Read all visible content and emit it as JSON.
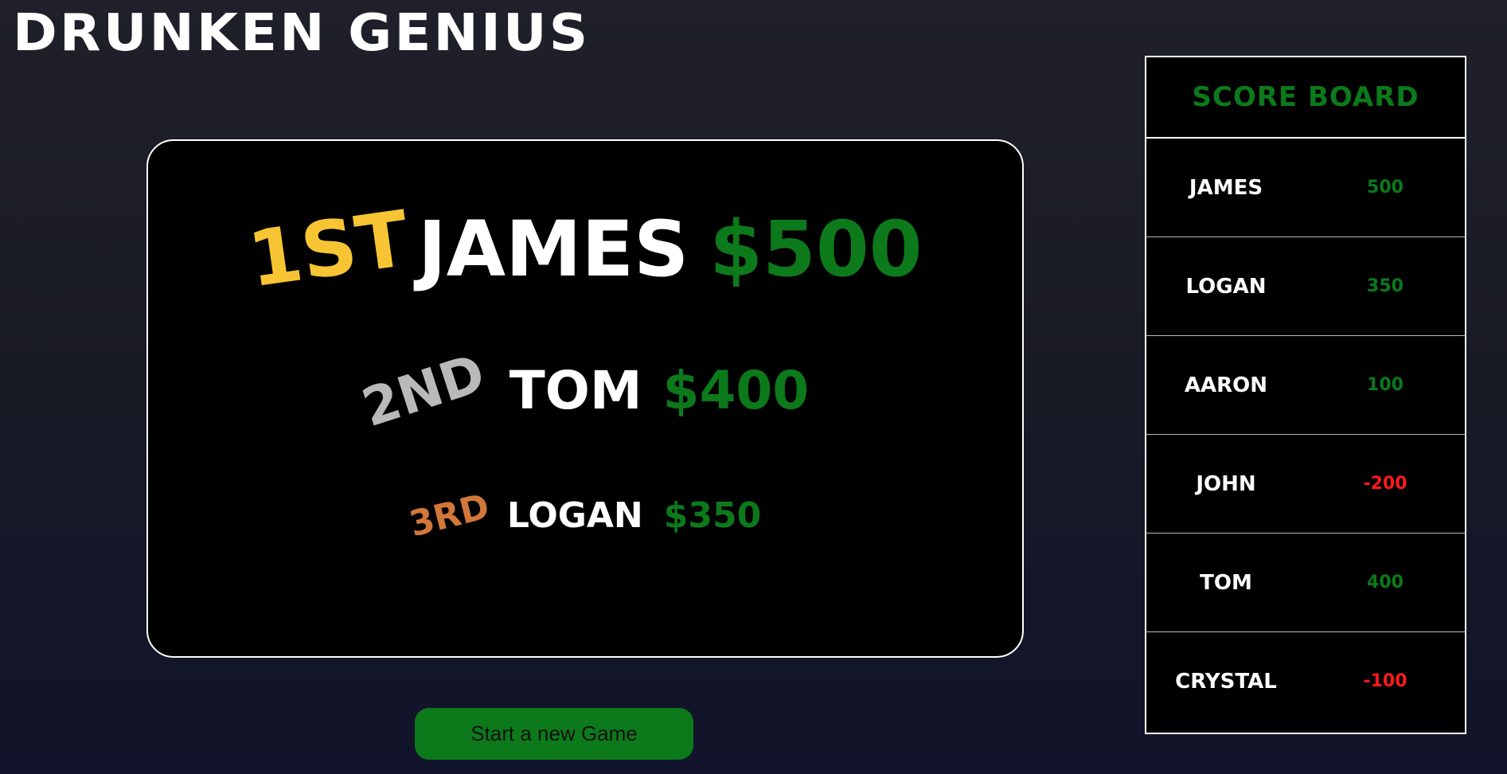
{
  "app": {
    "title": "Drunken Genius"
  },
  "colors": {
    "gold": "#f7c534",
    "silver": "#b9b9b9",
    "bronze": "#d2773a",
    "money_positive": "#0c7a1b",
    "money_negative": "#ff1a1a",
    "panel_background": "#000000",
    "page_background": "#1c1d28"
  },
  "podium": [
    {
      "place": "1st",
      "name": "James",
      "amount": "$500"
    },
    {
      "place": "2nd",
      "name": "Tom",
      "amount": "$400"
    },
    {
      "place": "3rd",
      "name": "Logan",
      "amount": "$350"
    }
  ],
  "actions": {
    "new_game_label": "Start a new Game"
  },
  "scoreboard": {
    "title": "Score Board",
    "rows": [
      {
        "player": "James",
        "score": "500",
        "status": "positive"
      },
      {
        "player": "Logan",
        "score": "350",
        "status": "positive"
      },
      {
        "player": "Aaron",
        "score": "100",
        "status": "positive"
      },
      {
        "player": "John",
        "score": "-200",
        "status": "negative"
      },
      {
        "player": "Tom",
        "score": "400",
        "status": "positive"
      },
      {
        "player": "Crystal",
        "score": "-100",
        "status": "negative"
      }
    ]
  }
}
